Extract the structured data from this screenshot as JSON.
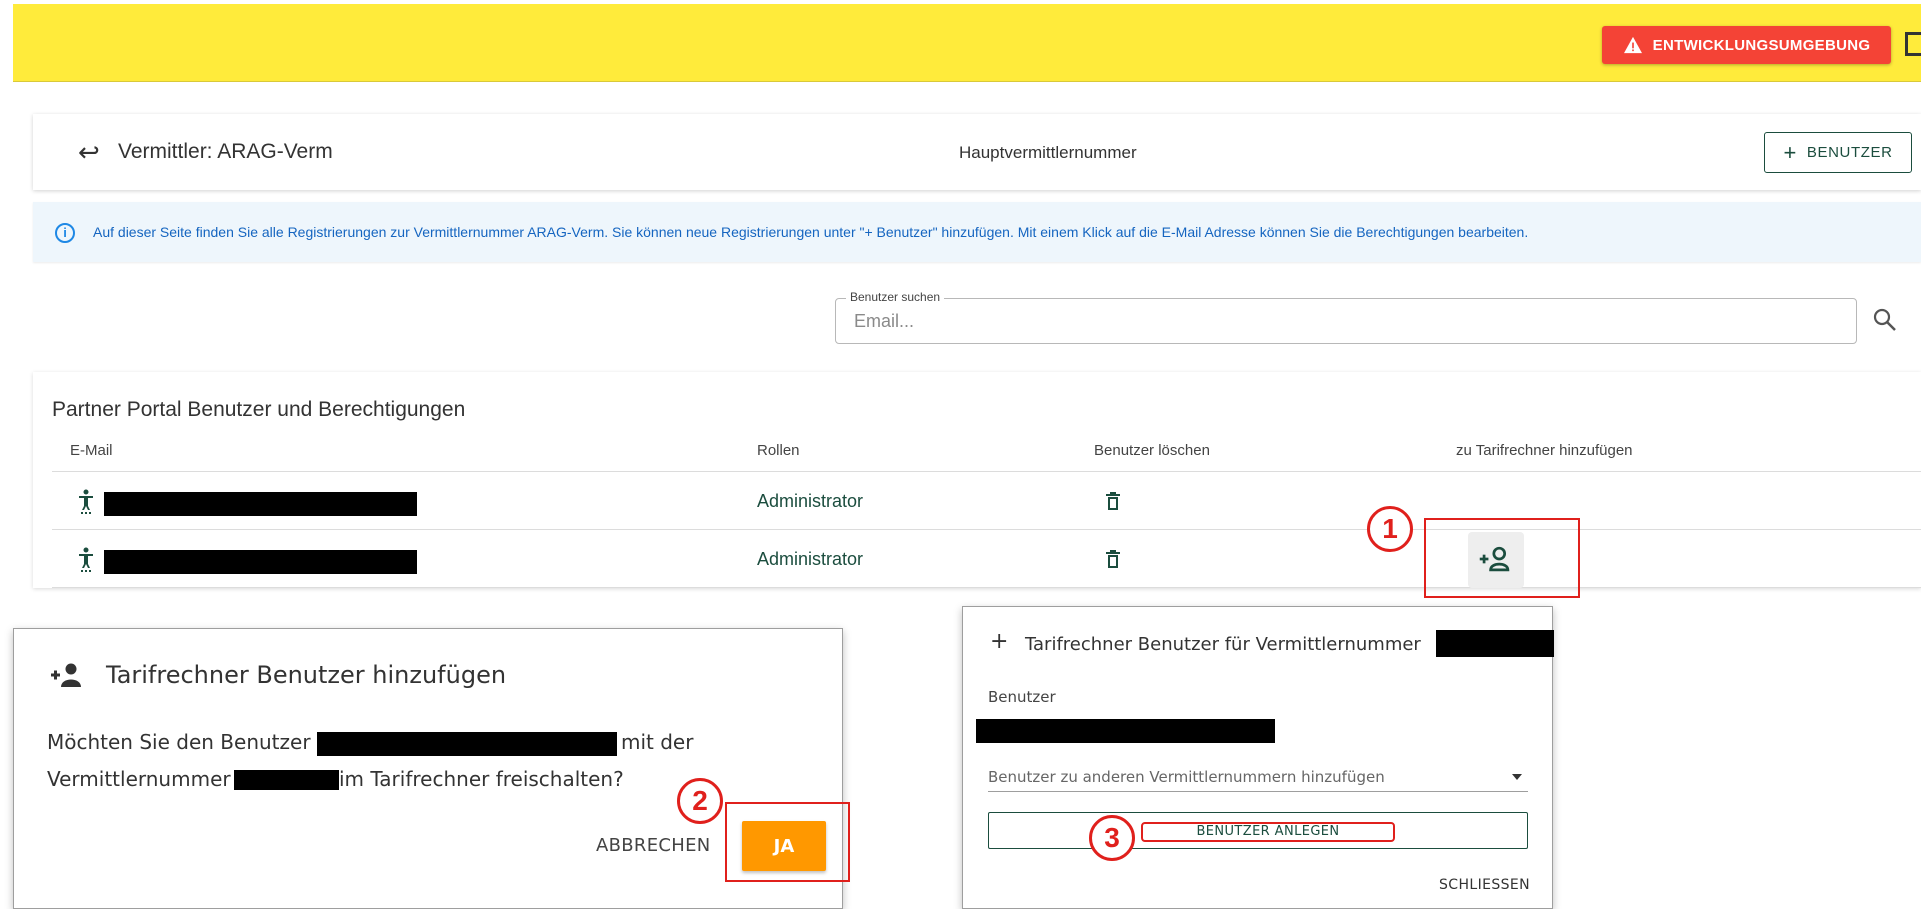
{
  "topbar": {
    "env_badge_label": "ENTWICKLUNGSUMGEBUNG",
    "accent_color": "#ffeb3b",
    "badge_color": "#f44336"
  },
  "header": {
    "title": "Vermittler: ARAG-Verm",
    "center_label": "Hauptvermittlernummer",
    "add_user_button": "BENUTZER"
  },
  "info": {
    "text": "Auf dieser Seite finden Sie alle Registrierungen zur Vermittlernummer ARAG-Verm. Sie können neue Registrierungen unter \"+ Benutzer\" hinzufügen. Mit einem Klick auf die E-Mail Adresse können Sie die Berechtigungen bearbeiten."
  },
  "search": {
    "legend": "Benutzer suchen",
    "placeholder": "Email..."
  },
  "table": {
    "title": "Partner Portal Benutzer und Berechtigungen",
    "columns": [
      "E-Mail",
      "Rollen",
      "Benutzer löschen",
      "zu Tarifrechner hinzufügen"
    ],
    "rows": [
      {
        "email": "",
        "role": "Administrator"
      },
      {
        "email": "",
        "role": "Administrator"
      }
    ]
  },
  "annotations": [
    "1",
    "2",
    "3"
  ],
  "dialog_confirm": {
    "title": "Tarifrechner Benutzer hinzufügen",
    "text_part1": "Möchten Sie den Benutzer",
    "text_part2": "mit der",
    "text_part3": "Vermittlernummer",
    "text_part4": "im Tarifrechner freischalten?",
    "cancel_label": "ABBRECHEN",
    "confirm_label": "JA"
  },
  "dialog_create": {
    "title": "Tarifrechner Benutzer für Vermittlernummer",
    "user_label": "Benutzer",
    "select_placeholder": "Benutzer zu anderen Vermittlernummern hinzufügen",
    "create_button": "BENUTZER ANLEGEN",
    "close_label": "SCHLIESSEN"
  }
}
